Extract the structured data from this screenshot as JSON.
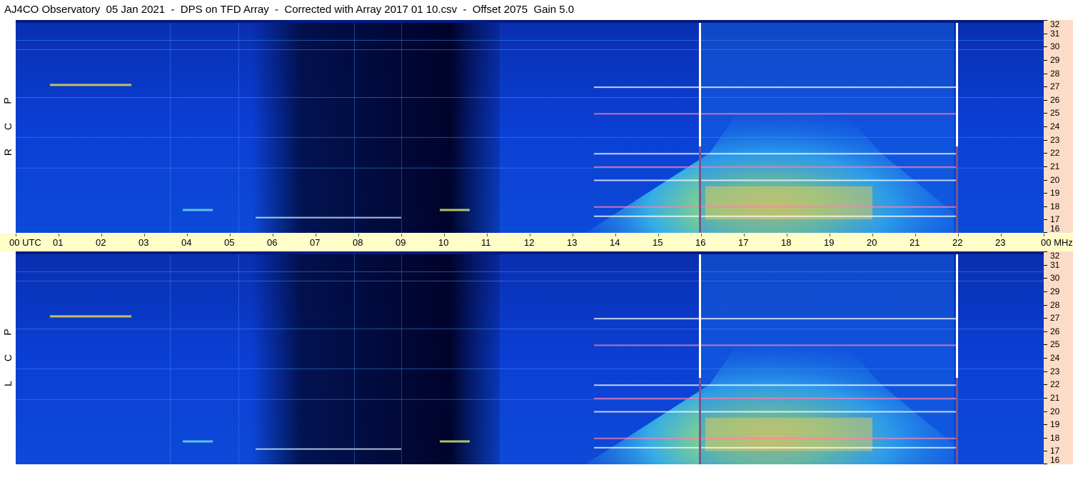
{
  "header": {
    "title": "AJ4CO Observatory  05 Jan 2021  -  DPS on TFD Array  -  Corrected with Array 2017 01 10.csv  -  Offset 2075  Gain 5.0"
  },
  "panels": [
    {
      "id": "rcp",
      "label_letters": [
        "P",
        "C",
        "R"
      ]
    },
    {
      "id": "lcp",
      "label_letters": [
        "P",
        "C",
        "L"
      ]
    }
  ],
  "time_axis": {
    "labels": [
      "00 UTC",
      "01",
      "02",
      "03",
      "04",
      "05",
      "06",
      "07",
      "08",
      "09",
      "10",
      "11",
      "12",
      "13",
      "14",
      "15",
      "16",
      "17",
      "18",
      "19",
      "20",
      "21",
      "22",
      "23",
      "00 MHz"
    ]
  },
  "freq_axis": {
    "labels": [
      "32",
      "31",
      "30",
      "29",
      "28",
      "27",
      "26",
      "25",
      "24",
      "23",
      "22",
      "21",
      "20",
      "19",
      "18",
      "17",
      "16"
    ]
  },
  "chart_data": {
    "type": "heatmap",
    "title": "AJ4CO Observatory  05 Jan 2021  -  DPS on TFD Array  -  Corrected with Array 2017 01 10.csv  -  Offset 2075  Gain 5.0",
    "x": {
      "unit": "UTC",
      "range": [
        0,
        24
      ],
      "ticks": [
        "00 UTC",
        "01",
        "02",
        "03",
        "04",
        "05",
        "06",
        "07",
        "08",
        "09",
        "10",
        "11",
        "12",
        "13",
        "14",
        "15",
        "16",
        "17",
        "18",
        "19",
        "20",
        "21",
        "22",
        "23",
        "00"
      ]
    },
    "y": {
      "unit": "MHz",
      "range": [
        16,
        32
      ],
      "ticks": [
        32,
        31,
        30,
        29,
        28,
        27,
        26,
        25,
        24,
        23,
        22,
        21,
        20,
        19,
        18,
        17,
        16
      ]
    },
    "series": [
      {
        "name": "R C P"
      },
      {
        "name": "L C P"
      }
    ],
    "colormap": [
      "#000022",
      "#00135a",
      "#0a3fd6",
      "#1a78f0",
      "#3cc8e6",
      "#8de67a",
      "#e8f25a",
      "#f2b040",
      "#ff4080",
      "#ffffff"
    ],
    "features": {
      "day_noise_peak_utc": [
        16,
        21.9
      ],
      "night_quiet_utc": [
        5.5,
        11.3
      ],
      "calibration_markers_utc": [
        15.95,
        21.95
      ],
      "strong_emission_band_mhz": [
        17,
        19.5
      ],
      "rfi_lines_mhz": [
        27,
        25,
        22,
        21,
        20,
        18,
        17.3
      ]
    }
  }
}
